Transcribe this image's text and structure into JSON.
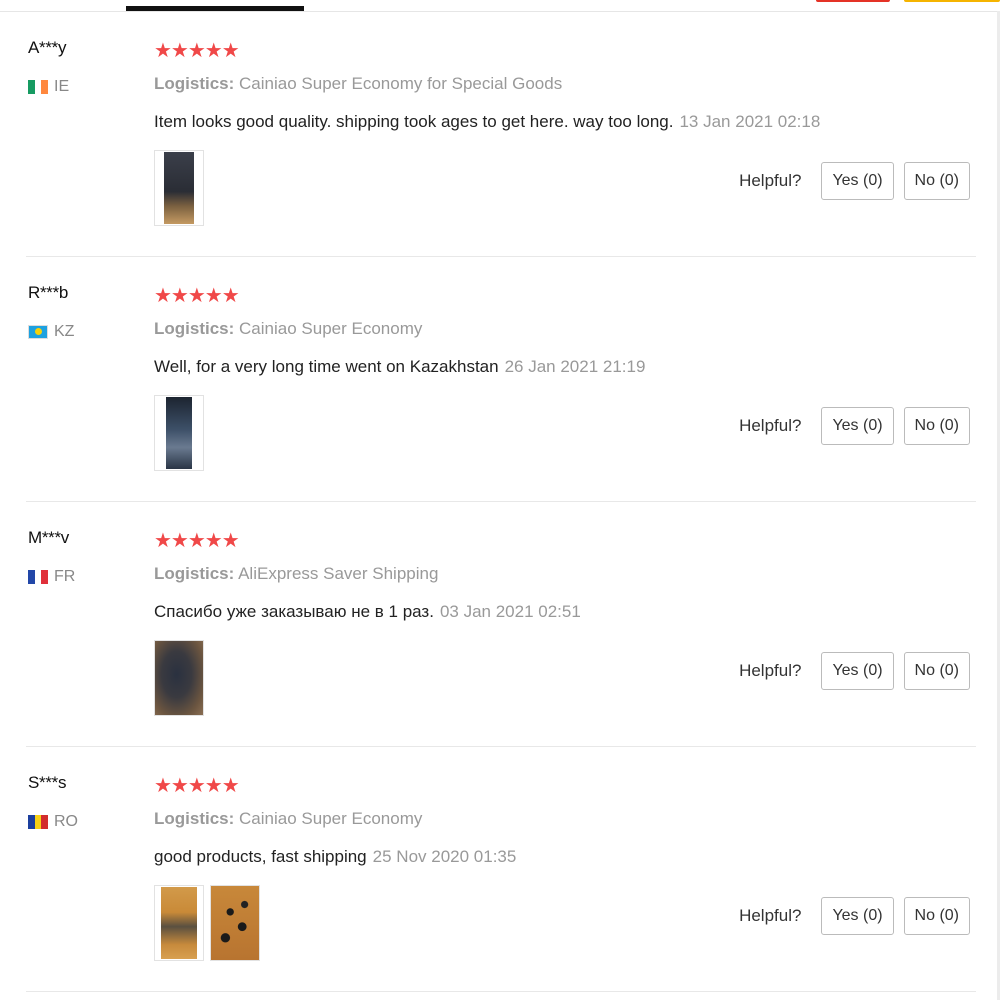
{
  "helpful_label": "Helpful?",
  "reviews": [
    {
      "user": "A***y",
      "country": "IE",
      "stars": "★★★★★",
      "logistics_label": "Logistics:",
      "logistics": "Cainiao Super Economy for Special Goods",
      "text": "Item looks good quality. shipping took ages to get here. way too long.",
      "date": "13 Jan 2021 02:18",
      "yes": "Yes (0)",
      "no": "No (0)"
    },
    {
      "user": "R***b",
      "country": "KZ",
      "stars": "★★★★★",
      "logistics_label": "Logistics:",
      "logistics": "Cainiao Super Economy",
      "text": "Well, for a very long time went on Kazakhstan",
      "date": "26 Jan 2021 21:19",
      "yes": "Yes (0)",
      "no": "No (0)"
    },
    {
      "user": "M***v",
      "country": "FR",
      "stars": "★★★★★",
      "logistics_label": "Logistics:",
      "logistics": "AliExpress Saver Shipping",
      "text": "Спасибо уже заказываю не в 1 раз.",
      "date": "03 Jan 2021 02:51",
      "yes": "Yes (0)",
      "no": "No (0)"
    },
    {
      "user": "S***s",
      "country": "RO",
      "stars": "★★★★★",
      "logistics_label": "Logistics:",
      "logistics": "Cainiao Super Economy",
      "text": "good products, fast shipping",
      "date": "25 Nov 2020 01:35",
      "yes": "Yes (0)",
      "no": "No (0)"
    }
  ]
}
